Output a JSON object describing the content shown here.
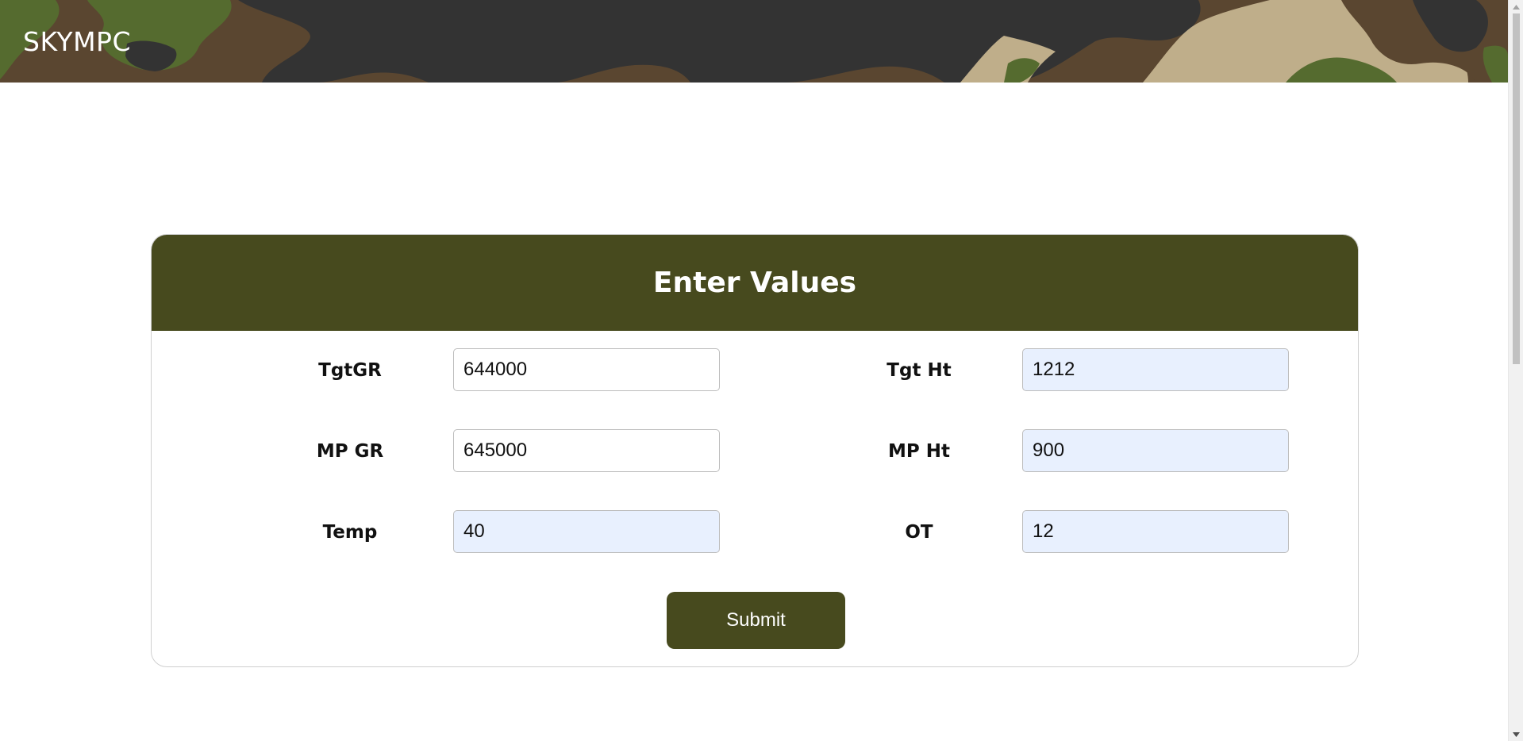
{
  "header": {
    "brand": "SKYMPC"
  },
  "form": {
    "title": "Enter Values",
    "fields": [
      {
        "label": "TgtGR",
        "value": "644000"
      },
      {
        "label": "Tgt Ht",
        "value": "1212"
      },
      {
        "label": "MP GR",
        "value": "645000"
      },
      {
        "label": "MP Ht",
        "value": "900"
      },
      {
        "label": "Temp",
        "value": "40"
      },
      {
        "label": "OT",
        "value": "12"
      }
    ],
    "submit_label": "Submit"
  },
  "colors": {
    "primary": "#474a1e",
    "autofill_background": "#e8f0fe",
    "camo_dark": "#333333",
    "camo_green": "#556b2f",
    "camo_brown": "#5a4630",
    "camo_tan": "#bfae8a"
  },
  "icons": {
    "scroll_up": "triangle-up-icon",
    "scroll_down": "triangle-down-icon"
  }
}
